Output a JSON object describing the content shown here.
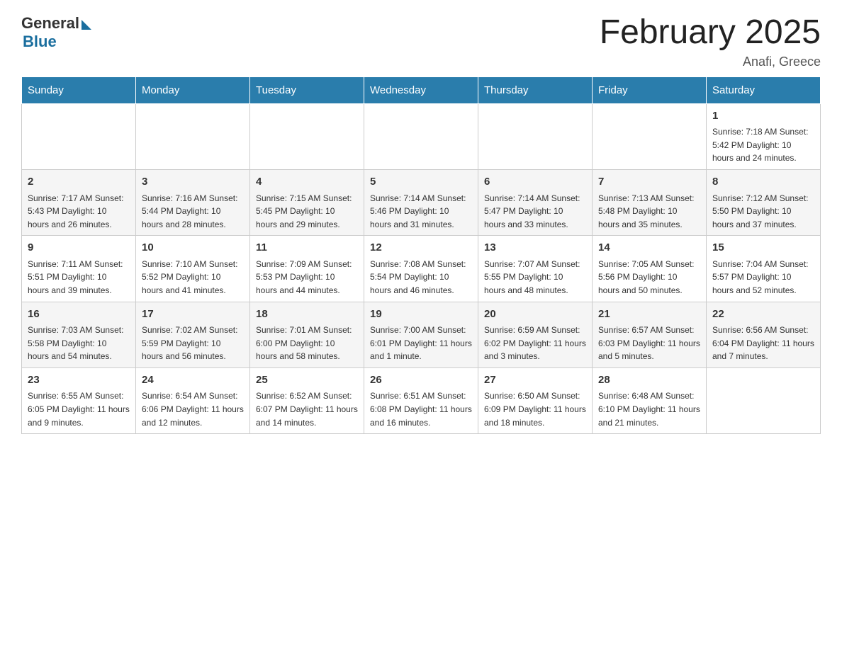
{
  "header": {
    "logo_general": "General",
    "logo_blue": "Blue",
    "month_title": "February 2025",
    "location": "Anafi, Greece"
  },
  "weekdays": [
    "Sunday",
    "Monday",
    "Tuesday",
    "Wednesday",
    "Thursday",
    "Friday",
    "Saturday"
  ],
  "weeks": [
    [
      {
        "day": "",
        "info": ""
      },
      {
        "day": "",
        "info": ""
      },
      {
        "day": "",
        "info": ""
      },
      {
        "day": "",
        "info": ""
      },
      {
        "day": "",
        "info": ""
      },
      {
        "day": "",
        "info": ""
      },
      {
        "day": "1",
        "info": "Sunrise: 7:18 AM\nSunset: 5:42 PM\nDaylight: 10 hours\nand 24 minutes."
      }
    ],
    [
      {
        "day": "2",
        "info": "Sunrise: 7:17 AM\nSunset: 5:43 PM\nDaylight: 10 hours\nand 26 minutes."
      },
      {
        "day": "3",
        "info": "Sunrise: 7:16 AM\nSunset: 5:44 PM\nDaylight: 10 hours\nand 28 minutes."
      },
      {
        "day": "4",
        "info": "Sunrise: 7:15 AM\nSunset: 5:45 PM\nDaylight: 10 hours\nand 29 minutes."
      },
      {
        "day": "5",
        "info": "Sunrise: 7:14 AM\nSunset: 5:46 PM\nDaylight: 10 hours\nand 31 minutes."
      },
      {
        "day": "6",
        "info": "Sunrise: 7:14 AM\nSunset: 5:47 PM\nDaylight: 10 hours\nand 33 minutes."
      },
      {
        "day": "7",
        "info": "Sunrise: 7:13 AM\nSunset: 5:48 PM\nDaylight: 10 hours\nand 35 minutes."
      },
      {
        "day": "8",
        "info": "Sunrise: 7:12 AM\nSunset: 5:50 PM\nDaylight: 10 hours\nand 37 minutes."
      }
    ],
    [
      {
        "day": "9",
        "info": "Sunrise: 7:11 AM\nSunset: 5:51 PM\nDaylight: 10 hours\nand 39 minutes."
      },
      {
        "day": "10",
        "info": "Sunrise: 7:10 AM\nSunset: 5:52 PM\nDaylight: 10 hours\nand 41 minutes."
      },
      {
        "day": "11",
        "info": "Sunrise: 7:09 AM\nSunset: 5:53 PM\nDaylight: 10 hours\nand 44 minutes."
      },
      {
        "day": "12",
        "info": "Sunrise: 7:08 AM\nSunset: 5:54 PM\nDaylight: 10 hours\nand 46 minutes."
      },
      {
        "day": "13",
        "info": "Sunrise: 7:07 AM\nSunset: 5:55 PM\nDaylight: 10 hours\nand 48 minutes."
      },
      {
        "day": "14",
        "info": "Sunrise: 7:05 AM\nSunset: 5:56 PM\nDaylight: 10 hours\nand 50 minutes."
      },
      {
        "day": "15",
        "info": "Sunrise: 7:04 AM\nSunset: 5:57 PM\nDaylight: 10 hours\nand 52 minutes."
      }
    ],
    [
      {
        "day": "16",
        "info": "Sunrise: 7:03 AM\nSunset: 5:58 PM\nDaylight: 10 hours\nand 54 minutes."
      },
      {
        "day": "17",
        "info": "Sunrise: 7:02 AM\nSunset: 5:59 PM\nDaylight: 10 hours\nand 56 minutes."
      },
      {
        "day": "18",
        "info": "Sunrise: 7:01 AM\nSunset: 6:00 PM\nDaylight: 10 hours\nand 58 minutes."
      },
      {
        "day": "19",
        "info": "Sunrise: 7:00 AM\nSunset: 6:01 PM\nDaylight: 11 hours\nand 1 minute."
      },
      {
        "day": "20",
        "info": "Sunrise: 6:59 AM\nSunset: 6:02 PM\nDaylight: 11 hours\nand 3 minutes."
      },
      {
        "day": "21",
        "info": "Sunrise: 6:57 AM\nSunset: 6:03 PM\nDaylight: 11 hours\nand 5 minutes."
      },
      {
        "day": "22",
        "info": "Sunrise: 6:56 AM\nSunset: 6:04 PM\nDaylight: 11 hours\nand 7 minutes."
      }
    ],
    [
      {
        "day": "23",
        "info": "Sunrise: 6:55 AM\nSunset: 6:05 PM\nDaylight: 11 hours\nand 9 minutes."
      },
      {
        "day": "24",
        "info": "Sunrise: 6:54 AM\nSunset: 6:06 PM\nDaylight: 11 hours\nand 12 minutes."
      },
      {
        "day": "25",
        "info": "Sunrise: 6:52 AM\nSunset: 6:07 PM\nDaylight: 11 hours\nand 14 minutes."
      },
      {
        "day": "26",
        "info": "Sunrise: 6:51 AM\nSunset: 6:08 PM\nDaylight: 11 hours\nand 16 minutes."
      },
      {
        "day": "27",
        "info": "Sunrise: 6:50 AM\nSunset: 6:09 PM\nDaylight: 11 hours\nand 18 minutes."
      },
      {
        "day": "28",
        "info": "Sunrise: 6:48 AM\nSunset: 6:10 PM\nDaylight: 11 hours\nand 21 minutes."
      },
      {
        "day": "",
        "info": ""
      }
    ]
  ]
}
